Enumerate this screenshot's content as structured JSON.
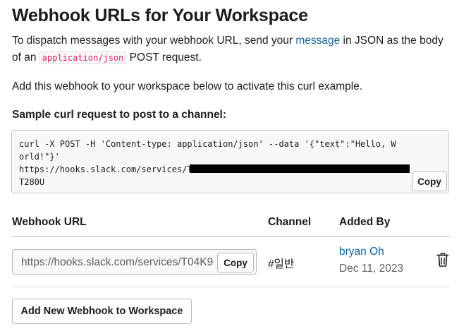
{
  "page": {
    "title": "Webhook URLs for Your Workspace",
    "intro_before_link": "To dispatch messages with your webhook URL, send your ",
    "intro_link": "message",
    "intro_after_link": " in JSON as the body of an ",
    "intro_code": "application/json",
    "intro_end": " POST request.",
    "add_hint": "Add this webhook to your workspace below to activate this curl example.",
    "sample_label": "Sample curl request to post to a channel:"
  },
  "sample": {
    "code": "curl -X POST -H 'Content-type: application/json' --data '{\"text\":\"Hello, World!\"}'\nhttps://hooks.slack.com/services/T\nT280U",
    "copy_label": "Copy"
  },
  "table": {
    "headers": {
      "url": "Webhook URL",
      "channel": "Channel",
      "added_by": "Added By"
    },
    "rows": [
      {
        "url": "https://hooks.slack.com/services/T04K9",
        "copy_label": "Copy",
        "channel": "#일반",
        "added_by_name": "bryan Oh",
        "added_date": "Dec 11, 2023"
      }
    ]
  },
  "actions": {
    "add_new": "Add New Webhook to Workspace"
  },
  "colors": {
    "link": "#1264a3",
    "inline_code": "#e01e5a",
    "text": "#1d1c1d",
    "muted": "#616061"
  },
  "icons": {
    "delete": "trash-icon"
  }
}
